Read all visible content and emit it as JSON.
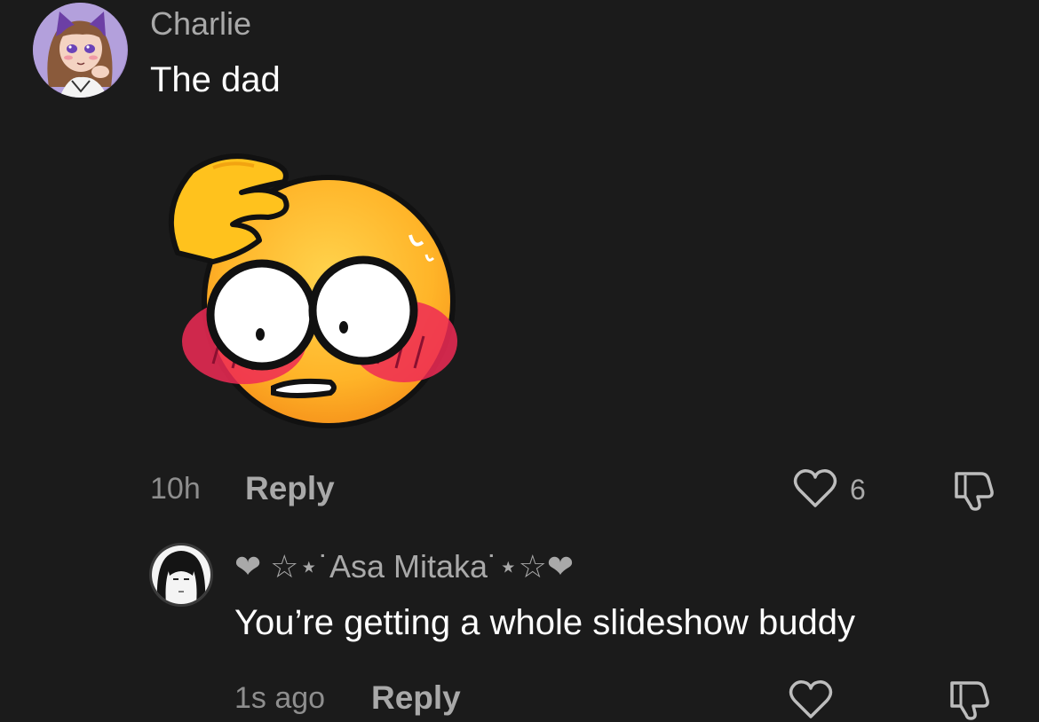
{
  "comments": [
    {
      "username": "Charlie",
      "text": "The dad",
      "time": "10h",
      "reply_label": "Reply",
      "likes": "6",
      "sticker": "flustered-face-emoji",
      "avatar": "anime-girl-avatar"
    }
  ],
  "replies": [
    {
      "username_prefix": "❤ ☆⋆˙",
      "username": "Asa Mitaka",
      "username_suffix": "˙⋆☆❤",
      "text": "You’re getting a whole slideshow buddy",
      "time": "1s ago",
      "reply_label": "Reply",
      "avatar": "anime-character-avatar"
    }
  ],
  "icons": {
    "like": "heart-outline-icon",
    "dislike": "thumbs-down-outline-icon"
  },
  "colors": {
    "background": "#1b1b1b",
    "username": "#a9a9a9",
    "text": "#ffffff",
    "meta": "#8e8e8e"
  }
}
